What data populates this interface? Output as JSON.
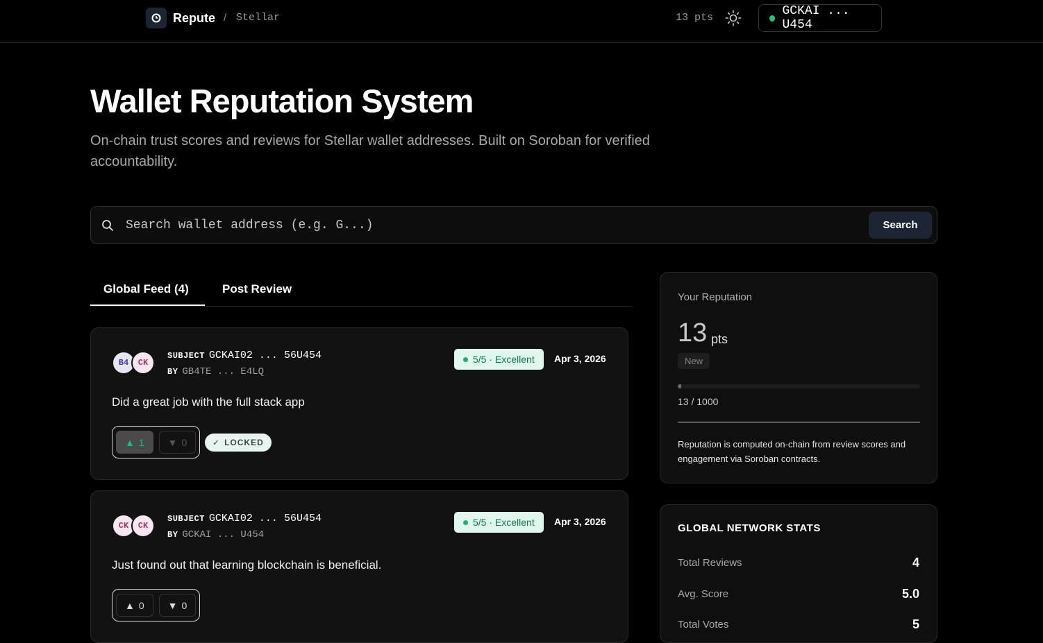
{
  "header": {
    "brand": "Repute",
    "separator": "/",
    "network": "Stellar",
    "points": "13 pts",
    "wallet": "GCKAI ... U454",
    "wallet_status_color": "#20c27a"
  },
  "hero": {
    "title": "Wallet Reputation System",
    "subtitle": "On-chain trust scores and reviews for Stellar wallet addresses. Built on Soroban for verified accountability."
  },
  "search": {
    "placeholder": "Search wallet address (e.g. G...)",
    "button_label": "Search"
  },
  "tabs": [
    {
      "label": "Global Feed (4)",
      "active": true
    },
    {
      "label": "Post Review",
      "active": false
    }
  ],
  "feed": [
    {
      "avatars": [
        "B4",
        "CK"
      ],
      "subject_label": "SUBJECT",
      "subject": "GCKAI02 ... 56U454",
      "by_label": "BY",
      "by": "GB4TE ... E4LQ",
      "score": "5/5 · Excellent",
      "date": "Apr 3, 2026",
      "text": "Did a great job with the full stack app",
      "upvotes": "1",
      "downvotes": "0",
      "status": "LOCKED"
    },
    {
      "avatars": [
        "CK",
        "CK"
      ],
      "subject_label": "SUBJECT",
      "subject": "GCKAI02 ... 56U454",
      "by_label": "BY",
      "by": "GCKAI ... U454",
      "score": "5/5 · Excellent",
      "date": "Apr 3, 2026",
      "text": "Just found out that learning blockchain is beneficial.",
      "upvotes": "0",
      "downvotes": "0"
    }
  ],
  "reputation": {
    "title": "Your Reputation",
    "score": "13",
    "unit": "pts",
    "level": "New",
    "progress_fraction": 0.013,
    "progress_text": "13 / 1000",
    "note": "Reputation is computed on-chain from review scores and engagement via Soroban contracts."
  },
  "stats": {
    "title": "GLOBAL NETWORK STATS",
    "rows": [
      {
        "label": "Total Reviews",
        "value": "4"
      },
      {
        "label": "Avg. Score",
        "value": "5.0"
      },
      {
        "label": "Total Votes",
        "value": "5"
      }
    ]
  },
  "colors": {
    "accent": "#1d2535",
    "success": "#1bb36e",
    "success_bg": "#dff7ec"
  }
}
